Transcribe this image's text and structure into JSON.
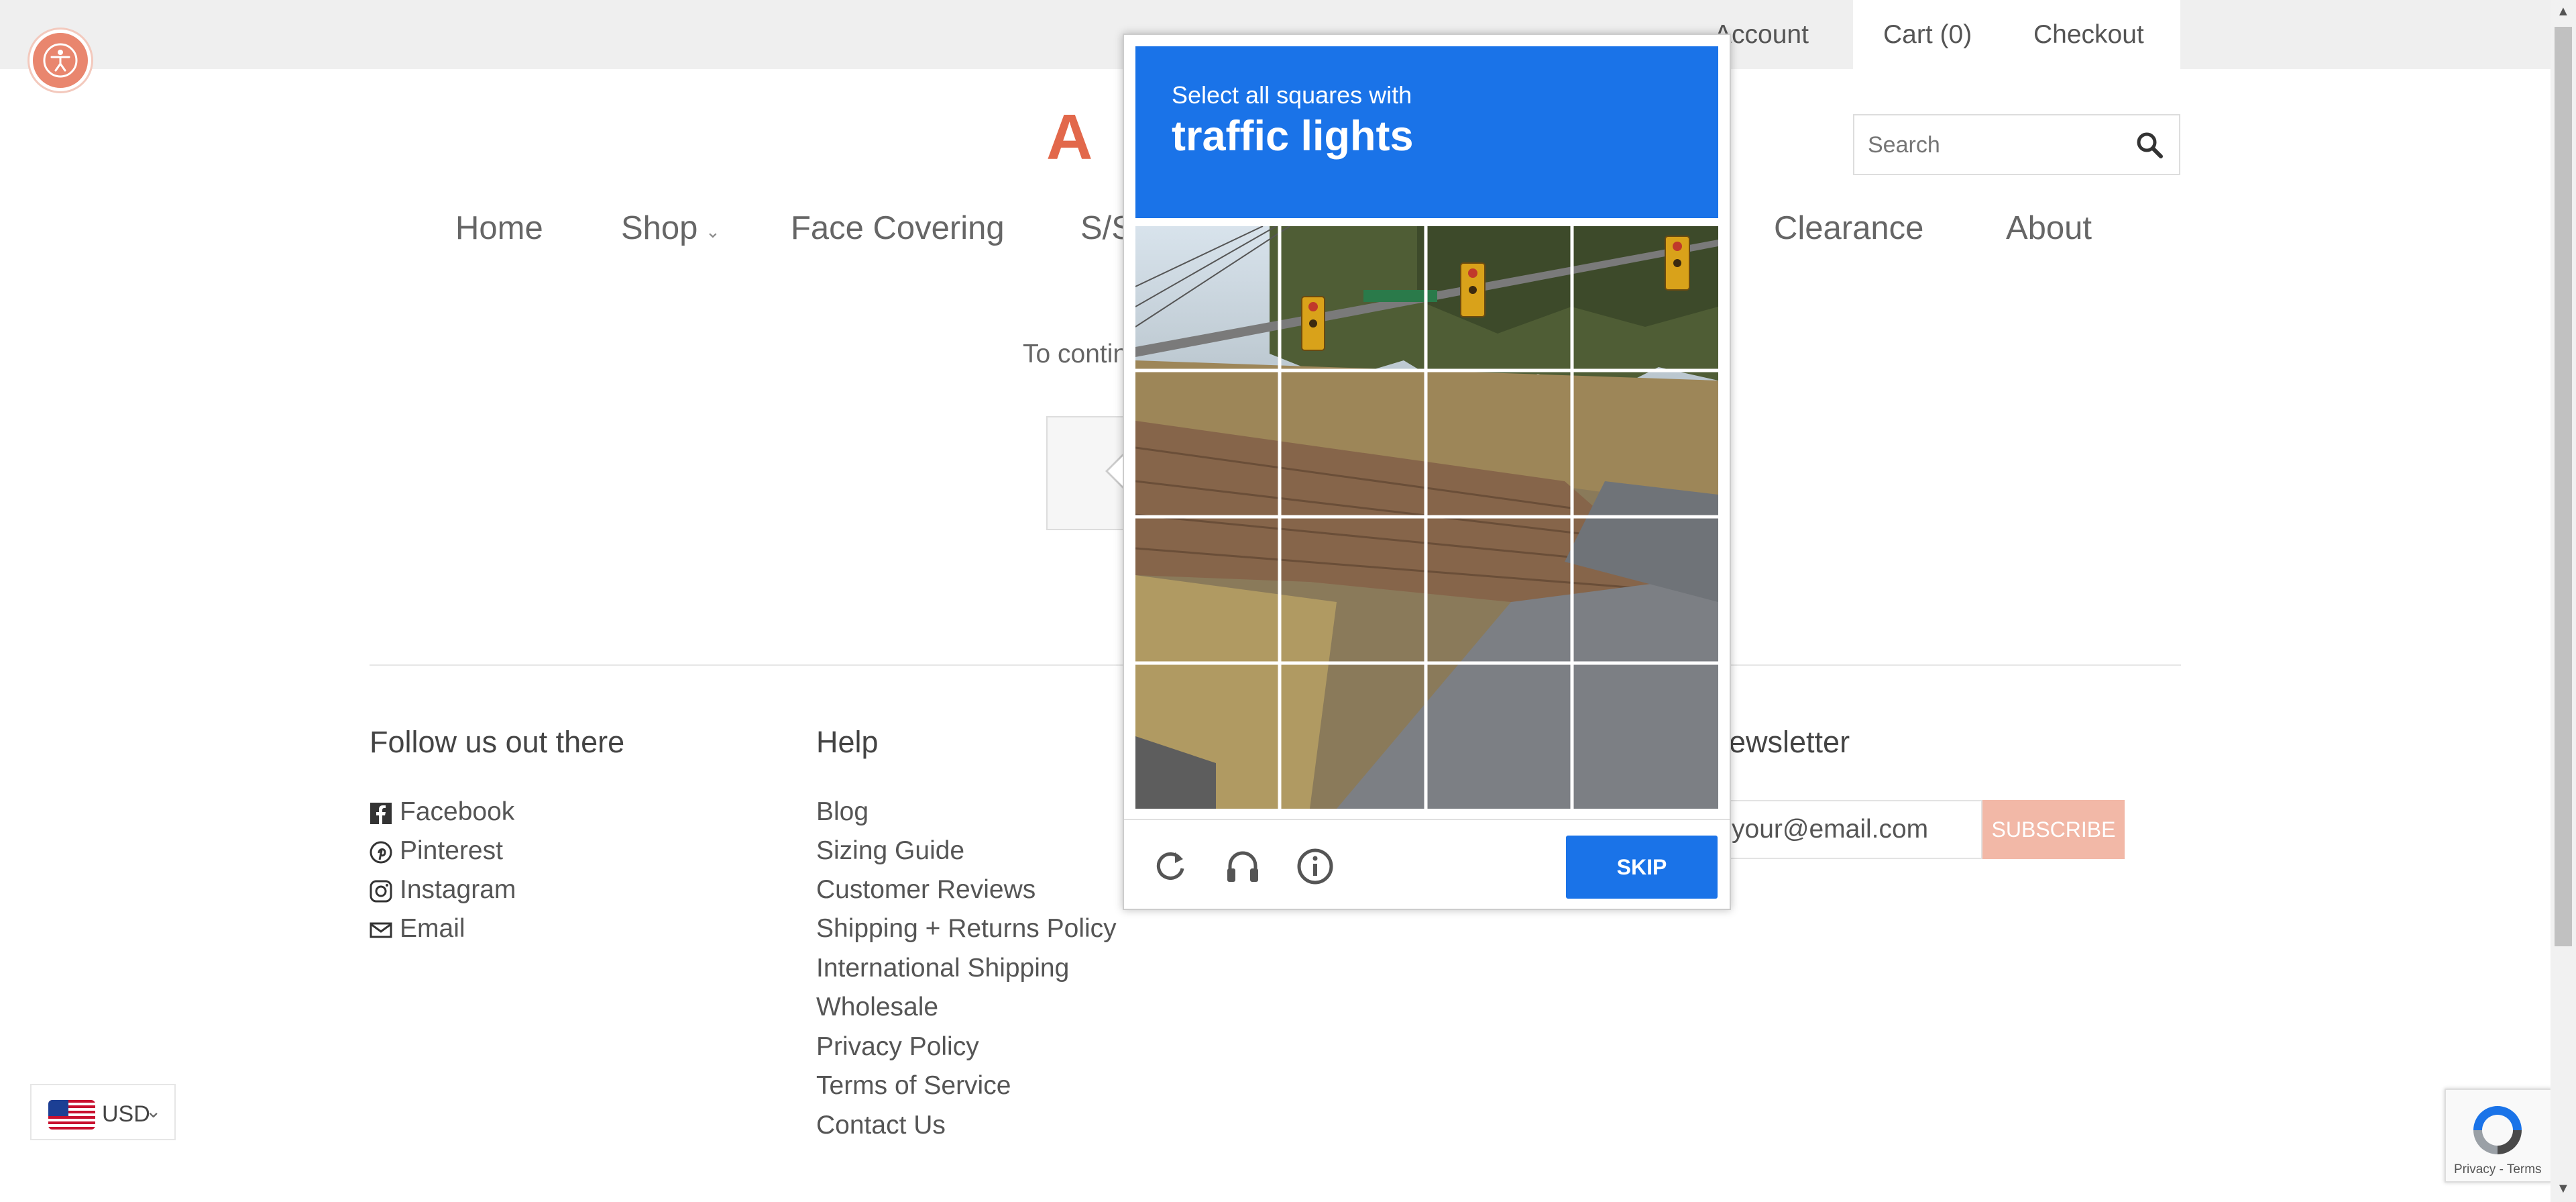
{
  "topbar": {
    "account": "Account",
    "cart": "Cart (0)",
    "checkout": "Checkout"
  },
  "logo": {
    "text": "A L"
  },
  "search": {
    "placeholder": "Search"
  },
  "nav": {
    "home": "Home",
    "shop": "Shop",
    "face_covering": "Face Covering",
    "ss_partial": "S/S",
    "clearance": "Clearance",
    "about": "About"
  },
  "main": {
    "continue_partial": "To contin"
  },
  "footer": {
    "follow": {
      "heading": "Follow us out there",
      "links": [
        "Facebook",
        "Pinterest",
        "Instagram",
        "Email"
      ]
    },
    "help": {
      "heading": "Help",
      "links": [
        "Blog",
        "Sizing Guide",
        "Customer Reviews",
        "Shipping + Returns Policy",
        "International Shipping",
        "Wholesale",
        "Privacy Policy",
        "Terms of Service",
        "Contact Us"
      ]
    },
    "newsletter": {
      "heading_partial": "ewsletter",
      "email_value": "your@email.com",
      "button": "SUBSCRIBE"
    }
  },
  "currency": {
    "code": "USD"
  },
  "recaptcha_badge": {
    "text": "Privacy - Terms"
  },
  "captcha": {
    "prompt": "Select all squares with",
    "target": "traffic lights",
    "skip": "SKIP",
    "icons": [
      "reload-icon",
      "audio-icon",
      "info-icon"
    ],
    "header_color": "#1a73e8"
  },
  "colors": {
    "accent": "#e2684b",
    "subscribe": "#f2b8a7",
    "captcha_blue": "#1a73e8"
  }
}
